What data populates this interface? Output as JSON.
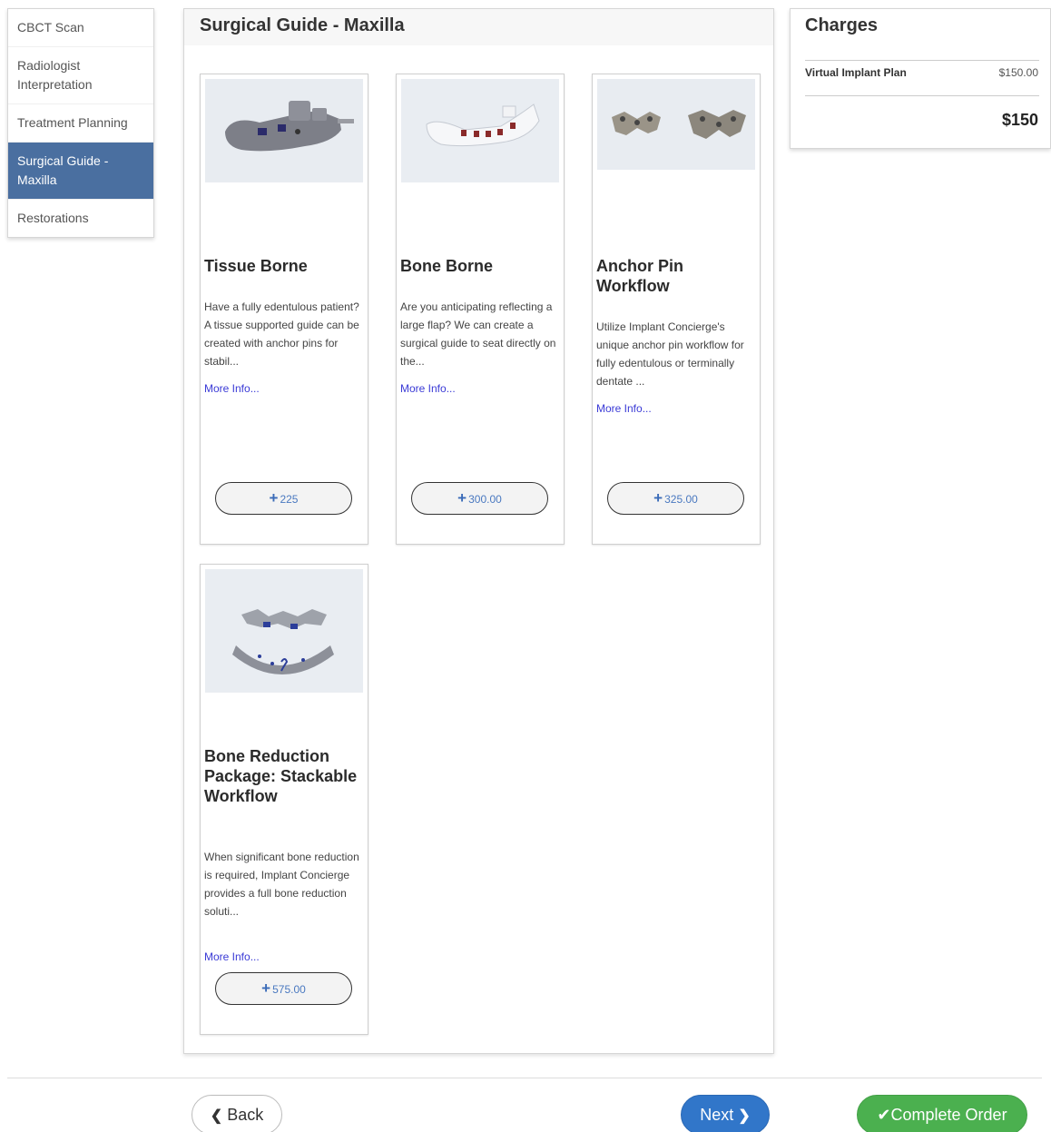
{
  "sidebar": {
    "items": [
      {
        "label": "CBCT Scan"
      },
      {
        "label": "Radiologist Interpretation"
      },
      {
        "label": "Treatment Planning"
      },
      {
        "label": "Surgical Guide - Maxilla"
      },
      {
        "label": "Restorations"
      }
    ]
  },
  "main": {
    "title": "Surgical Guide - Maxilla",
    "cards": [
      {
        "title": "Tissue Borne",
        "description": "Have a fully edentulous patient? A tissue supported guide can be created with anchor pins for stabil...",
        "more": "More Info...",
        "price": "225"
      },
      {
        "title": "Bone Borne",
        "description": "Are you anticipating reflecting a large flap? We can create a surgical guide to seat directly on the...",
        "more": "More Info...",
        "price": "300.00"
      },
      {
        "title": "Anchor Pin Workflow",
        "description": "Utilize Implant Concierge's unique anchor pin workflow for fully edentulous or terminally dentate ...",
        "more": "More Info...",
        "price": "325.00"
      },
      {
        "title": "Bone Reduction Package: Stackable Workflow",
        "description": "When significant bone reduction is required, Implant Concierge provides a full bone reduction soluti...",
        "more": "More Info...",
        "price": "575.00"
      }
    ]
  },
  "charges": {
    "title": "Charges",
    "items": [
      {
        "name": "Virtual Implant Plan",
        "amount": "$150.00"
      }
    ],
    "total": "$150"
  },
  "footer": {
    "back_label": "Back",
    "next_label": "Next",
    "complete_label": "Complete Order"
  },
  "colors": {
    "active_nav": "#4a6fa0",
    "next_button": "#3176c9",
    "complete_button": "#4bb04f",
    "link": "#3a3ad6"
  }
}
